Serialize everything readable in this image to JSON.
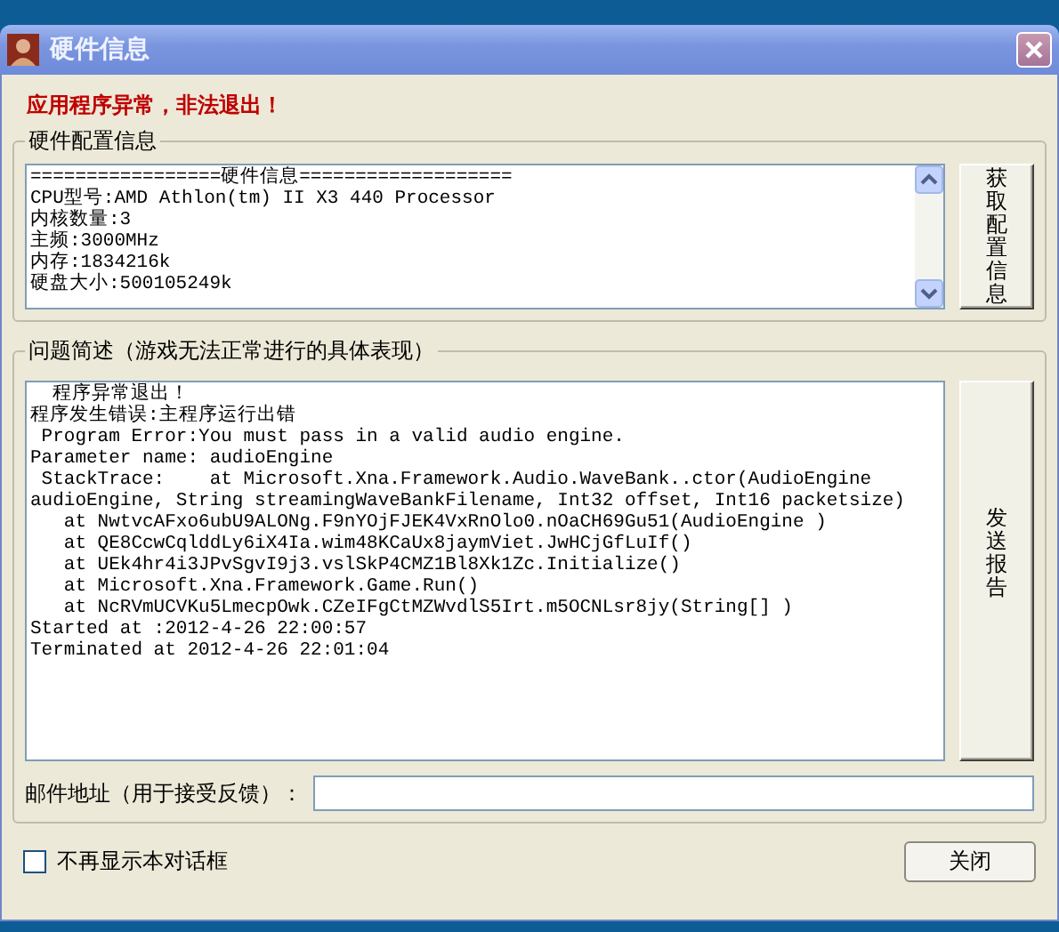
{
  "window": {
    "title": "硬件信息"
  },
  "error_message": "应用程序异常，非法退出！",
  "hardware": {
    "title": "硬件配置信息",
    "button": "获取配置信息",
    "lines": [
      "=================硬件信息===================",
      "CPU型号:AMD Athlon(tm) II X3 440 Processor",
      "内核数量:3",
      "主频:3000MHz",
      "内存:1834216k",
      "硬盘大小:500105249k"
    ]
  },
  "problem": {
    "title": "问题简述（游戏无法正常进行的具体表现）",
    "button": "发送报告",
    "lines": [
      "  程序异常退出！",
      "程序发生错误:主程序运行出错",
      " Program Error:You must pass in a valid audio engine.",
      "Parameter name: audioEngine",
      " StackTrace:    at Microsoft.Xna.Framework.Audio.WaveBank..ctor(AudioEngine",
      "audioEngine, String streamingWaveBankFilename, Int32 offset, Int16 packetsize)",
      "   at NwtvcAFxo6ubU9ALONg.F9nYOjFJEK4VxRnOlo0.nOaCH69Gu51(AudioEngine )",
      "   at QE8CcwCqlddLy6iX4Ia.wim48KCaUx8jaymViet.JwHCjGfLuIf()",
      "   at UEk4hr4i3JPvSgvI9j3.vslSkP4CMZ1Bl8Xk1Zc.Initialize()",
      "   at Microsoft.Xna.Framework.Game.Run()",
      "   at NcRVmUCVKu5LmecpOwk.CZeIFgCtMZWvdlS5Irt.m5OCNLsr8jy(String[] )",
      "Started at :2012-4-26 22:00:57",
      "Terminated at 2012-4-26 22:01:04"
    ]
  },
  "email": {
    "label": "邮件地址（用于接受反馈）："
  },
  "dont_show": {
    "label": "不再显示本对话框",
    "checked": false
  },
  "buttons": [
    "关闭"
  ]
}
